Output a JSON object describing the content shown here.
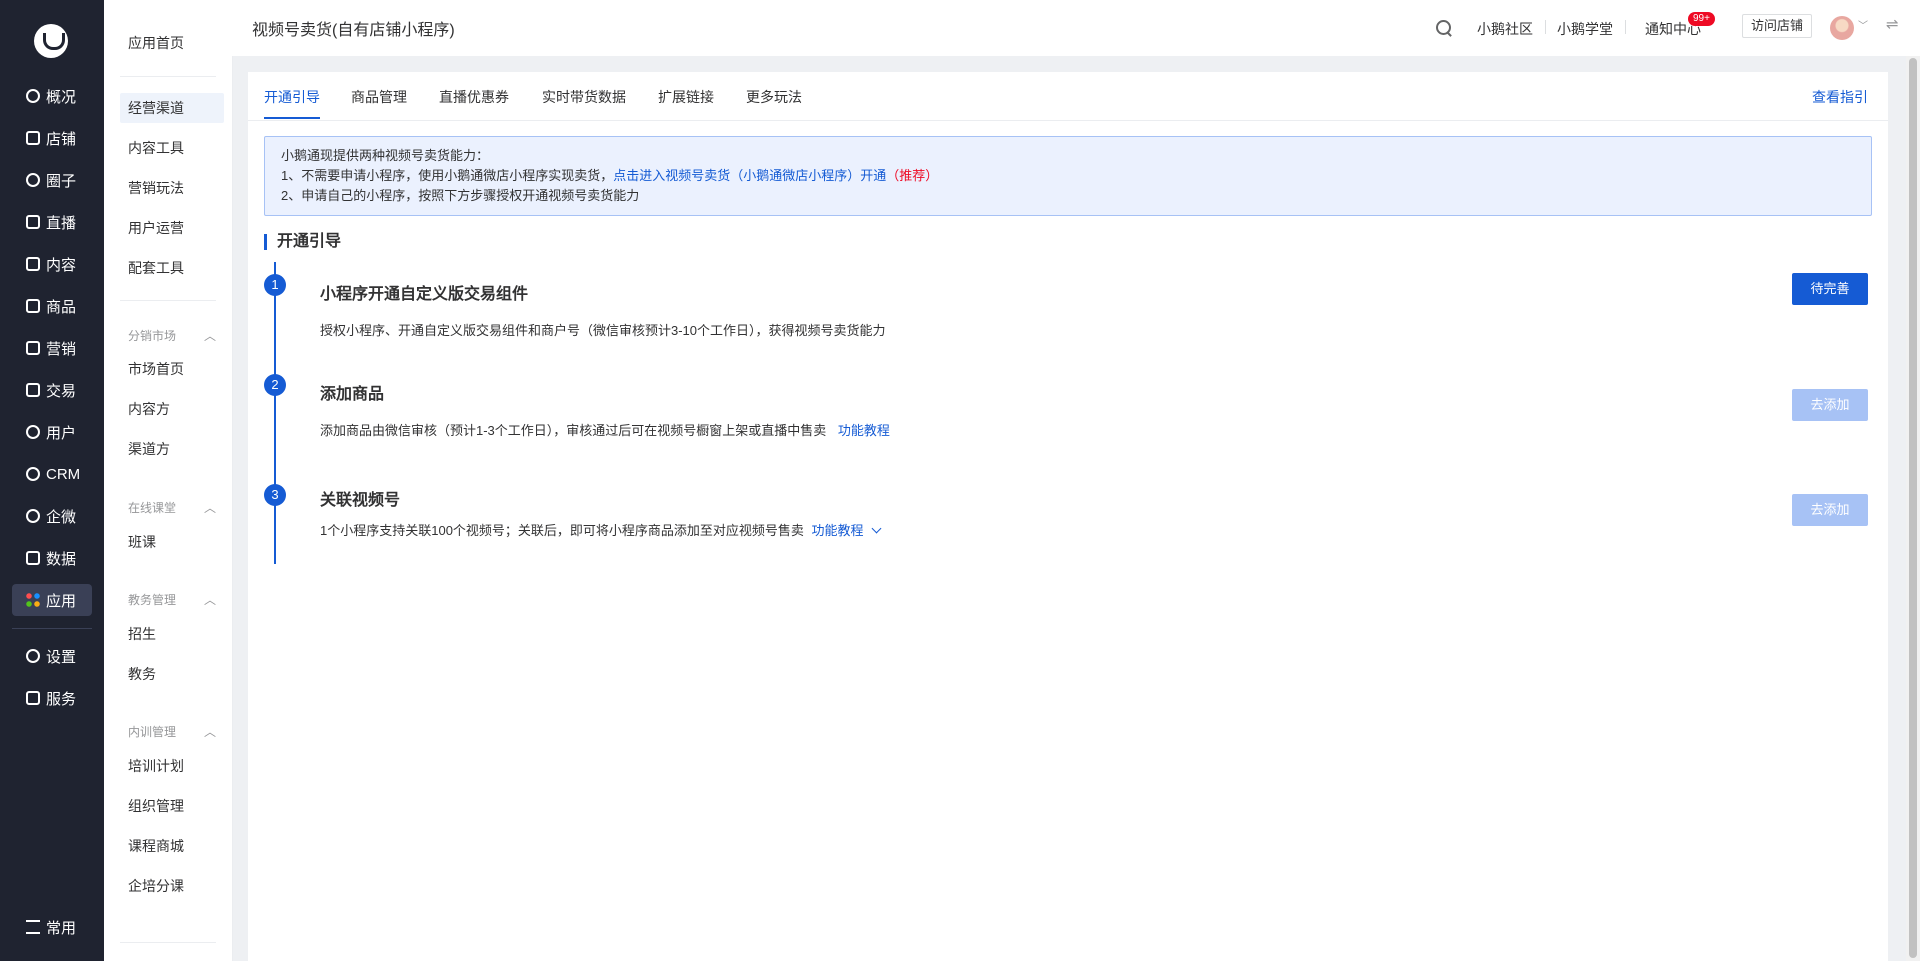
{
  "nav": {
    "items": [
      {
        "label": "概况",
        "icon": "chart-pie-icon"
      },
      {
        "label": "店铺",
        "icon": "shop-icon"
      },
      {
        "label": "圈子",
        "icon": "circle-group-icon"
      },
      {
        "label": "直播",
        "icon": "live-icon"
      },
      {
        "label": "内容",
        "icon": "document-icon"
      },
      {
        "label": "商品",
        "icon": "product-icon"
      },
      {
        "label": "营销",
        "icon": "megaphone-icon"
      },
      {
        "label": "交易",
        "icon": "transaction-icon"
      },
      {
        "label": "用户",
        "icon": "user-icon"
      },
      {
        "label": "CRM",
        "icon": "crm-icon"
      },
      {
        "label": "企微",
        "icon": "wecom-icon"
      },
      {
        "label": "数据",
        "icon": "data-icon"
      },
      {
        "label": "应用",
        "icon": "apps-icon"
      },
      {
        "label": "设置",
        "icon": "gear-icon"
      },
      {
        "label": "服务",
        "icon": "service-icon"
      }
    ],
    "common_label": "常用"
  },
  "subnav": {
    "home": "应用首页",
    "items1": [
      "经营渠道",
      "内容工具",
      "营销玩法",
      "用户运营",
      "配套工具"
    ],
    "group_distribution": "分销市场",
    "items2": [
      "市场首页",
      "内容方",
      "渠道方"
    ],
    "group_online": "在线课堂",
    "items3": [
      "班课"
    ],
    "group_edu": "教务管理",
    "items4": [
      "招生",
      "教务"
    ],
    "group_training": "内训管理",
    "items5": [
      "培训计划",
      "组织管理",
      "课程商城",
      "企培分课"
    ]
  },
  "header": {
    "title": "视频号卖货(自有店铺小程序)",
    "community": "小鹅社区",
    "academy": "小鹅学堂",
    "notifications": "通知中心",
    "badge": "99+",
    "visit_store": "访问店铺"
  },
  "tabs": [
    "开通引导",
    "商品管理",
    "直播优惠券",
    "实时带货数据",
    "扩展链接",
    "更多玩法"
  ],
  "guide_link": "查看指引",
  "notice": {
    "line1": "小鹅通现提供两种视频号卖货能力：",
    "line2_prefix": "1、不需要申请小程序，使用小鹅通微店小程序实现卖货，",
    "line2_link": "点击进入视频号卖货（小鹅通微店小程序）开通",
    "line2_tag": "（推荐）",
    "line3": "2、申请自己的小程序，按照下方步骤授权开通视频号卖货能力"
  },
  "section_title": "开通引导",
  "steps": [
    {
      "num": "1",
      "title": "小程序开通自定义版交易组件",
      "desc": "授权小程序、开通自定义版交易组件和商户号（微信审核预计3-10个工作日），获得视频号卖货能力",
      "button": "待完善"
    },
    {
      "num": "2",
      "title": "添加商品",
      "desc": "添加商品由微信审核（预计1-3个工作日），审核通过后可在视频号橱窗上架或直播中售卖",
      "link": "功能教程",
      "button": "去添加"
    },
    {
      "num": "3",
      "title": "关联视频号",
      "desc": "1个小程序支持关联100个视频号；关联后，即可将小程序商品添加至对应视频号售卖",
      "link": "功能教程",
      "button": "去添加"
    }
  ]
}
